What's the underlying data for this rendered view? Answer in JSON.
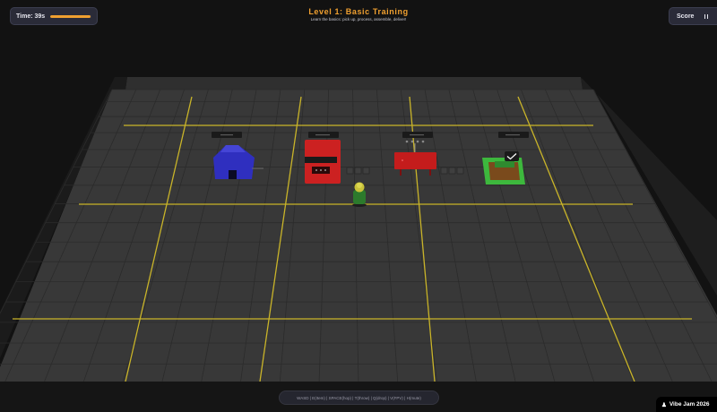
{
  "hud": {
    "time_label": "Time: 39s",
    "time_progress": 0.97,
    "score_label": "Score"
  },
  "level": {
    "title": "Level 1: Basic Training",
    "subtitle": "Learn the basics: pick up, process, assemble, deliver!"
  },
  "stations": [
    {
      "id": "input",
      "color": "#2f2fbf",
      "icon": "tent-icon"
    },
    {
      "id": "processor",
      "color": "#cc2121",
      "icon": "processor-machine-icon"
    },
    {
      "id": "assembly",
      "color": "#c41c1c",
      "icon": "assembly-table-icon"
    },
    {
      "id": "output",
      "color": "#3db83d",
      "icon": "delivery-box-icon"
    }
  ],
  "controls_text": "WASD | E(Item) | SPACE(hop) | T(throw) | Q(drop) | V(FPV) | H(mute)",
  "footer": {
    "badge_label": "Vibe Jam 2026"
  },
  "colors": {
    "floor": "#383838",
    "grid_major": "#c9b429",
    "wall": "#242424",
    "accent": "#f0a030"
  }
}
